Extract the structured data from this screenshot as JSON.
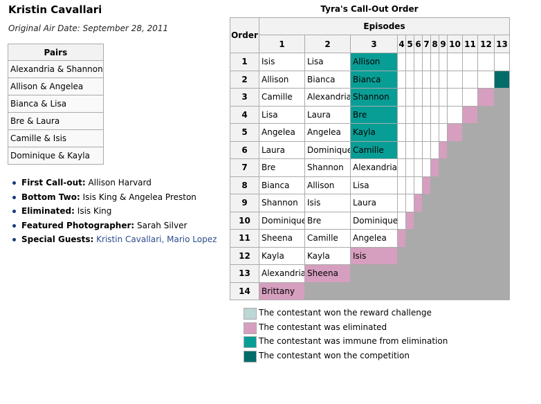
{
  "episode": {
    "title": "Kristin Cavallari",
    "air_date": "Original Air Date: September 28, 2011"
  },
  "pairs": {
    "header": "Pairs",
    "rows": [
      "Alexandria & Shannon",
      "Allison & Angelea",
      "Bianca & Lisa",
      "Bre & Laura",
      "Camille & Isis",
      "Dominique & Kayla"
    ]
  },
  "facts": [
    {
      "label": "First Call-out:",
      "value": "Allison Harvard"
    },
    {
      "label": "Bottom Two:",
      "value": "Isis King & Angelea Preston"
    },
    {
      "label": "Eliminated:",
      "value": "Isis King"
    },
    {
      "label": "Featured Photographer:",
      "value": "Sarah Silver"
    },
    {
      "label": "Special Guests:",
      "value": "Kristin Cavallari, Mario Lopez"
    }
  ],
  "callout": {
    "title": "Tyra's Call-Out Order",
    "order_header": "Order",
    "episodes_header": "Episodes",
    "episode_numbers": [
      "1",
      "2",
      "3",
      "4",
      "5",
      "6",
      "7",
      "8",
      "9",
      "10",
      "11",
      "12",
      "13"
    ],
    "rows": [
      {
        "order": "1",
        "ep1": "Isis",
        "ep2": "Lisa",
        "ep3": "Allison",
        "ep3_status": "immune"
      },
      {
        "order": "2",
        "ep1": "Allison",
        "ep2": "Bianca",
        "ep3": "Bianca",
        "ep3_status": "immune"
      },
      {
        "order": "3",
        "ep1": "Camille",
        "ep2": "Alexandria",
        "ep3": "Shannon",
        "ep3_status": "immune"
      },
      {
        "order": "4",
        "ep1": "Lisa",
        "ep2": "Laura",
        "ep3": "Bre",
        "ep3_status": "immune"
      },
      {
        "order": "5",
        "ep1": "Angelea",
        "ep2": "Angelea",
        "ep3": "Kayla",
        "ep3_status": "immune"
      },
      {
        "order": "6",
        "ep1": "Laura",
        "ep2": "Dominique",
        "ep3": "Camille",
        "ep3_status": "immune"
      },
      {
        "order": "7",
        "ep1": "Bre",
        "ep2": "Shannon",
        "ep3": "Alexandria",
        "ep3_status": ""
      },
      {
        "order": "8",
        "ep1": "Bianca",
        "ep2": "Allison",
        "ep3": "Lisa",
        "ep3_status": ""
      },
      {
        "order": "9",
        "ep1": "Shannon",
        "ep2": "Isis",
        "ep3": "Laura",
        "ep3_status": ""
      },
      {
        "order": "10",
        "ep1": "Dominique",
        "ep2": "Bre",
        "ep3": "Dominique",
        "ep3_status": ""
      },
      {
        "order": "11",
        "ep1": "Sheena",
        "ep2": "Camille",
        "ep3": "Angelea",
        "ep3_status": ""
      },
      {
        "order": "12",
        "ep1": "Kayla",
        "ep2": "Kayla",
        "ep3": "Isis",
        "ep3_status": "eliminated"
      },
      {
        "order": "13",
        "ep1": "Alexandria",
        "ep2": "Sheena",
        "ep3": "",
        "ep3_status": ""
      },
      {
        "order": "14",
        "ep1": "Brittany",
        "ep2": "",
        "ep3": "",
        "ep3_status": ""
      }
    ]
  },
  "legend": [
    {
      "color": "#bdd6d6",
      "text": "The contestant won the reward challenge"
    },
    {
      "color": "#d69fbf",
      "text": "The contestant was eliminated"
    },
    {
      "color": "#089e96",
      "text": "The contestant was immune from elimination"
    },
    {
      "color": "#046c68",
      "text": "The contestant won the competition"
    }
  ]
}
